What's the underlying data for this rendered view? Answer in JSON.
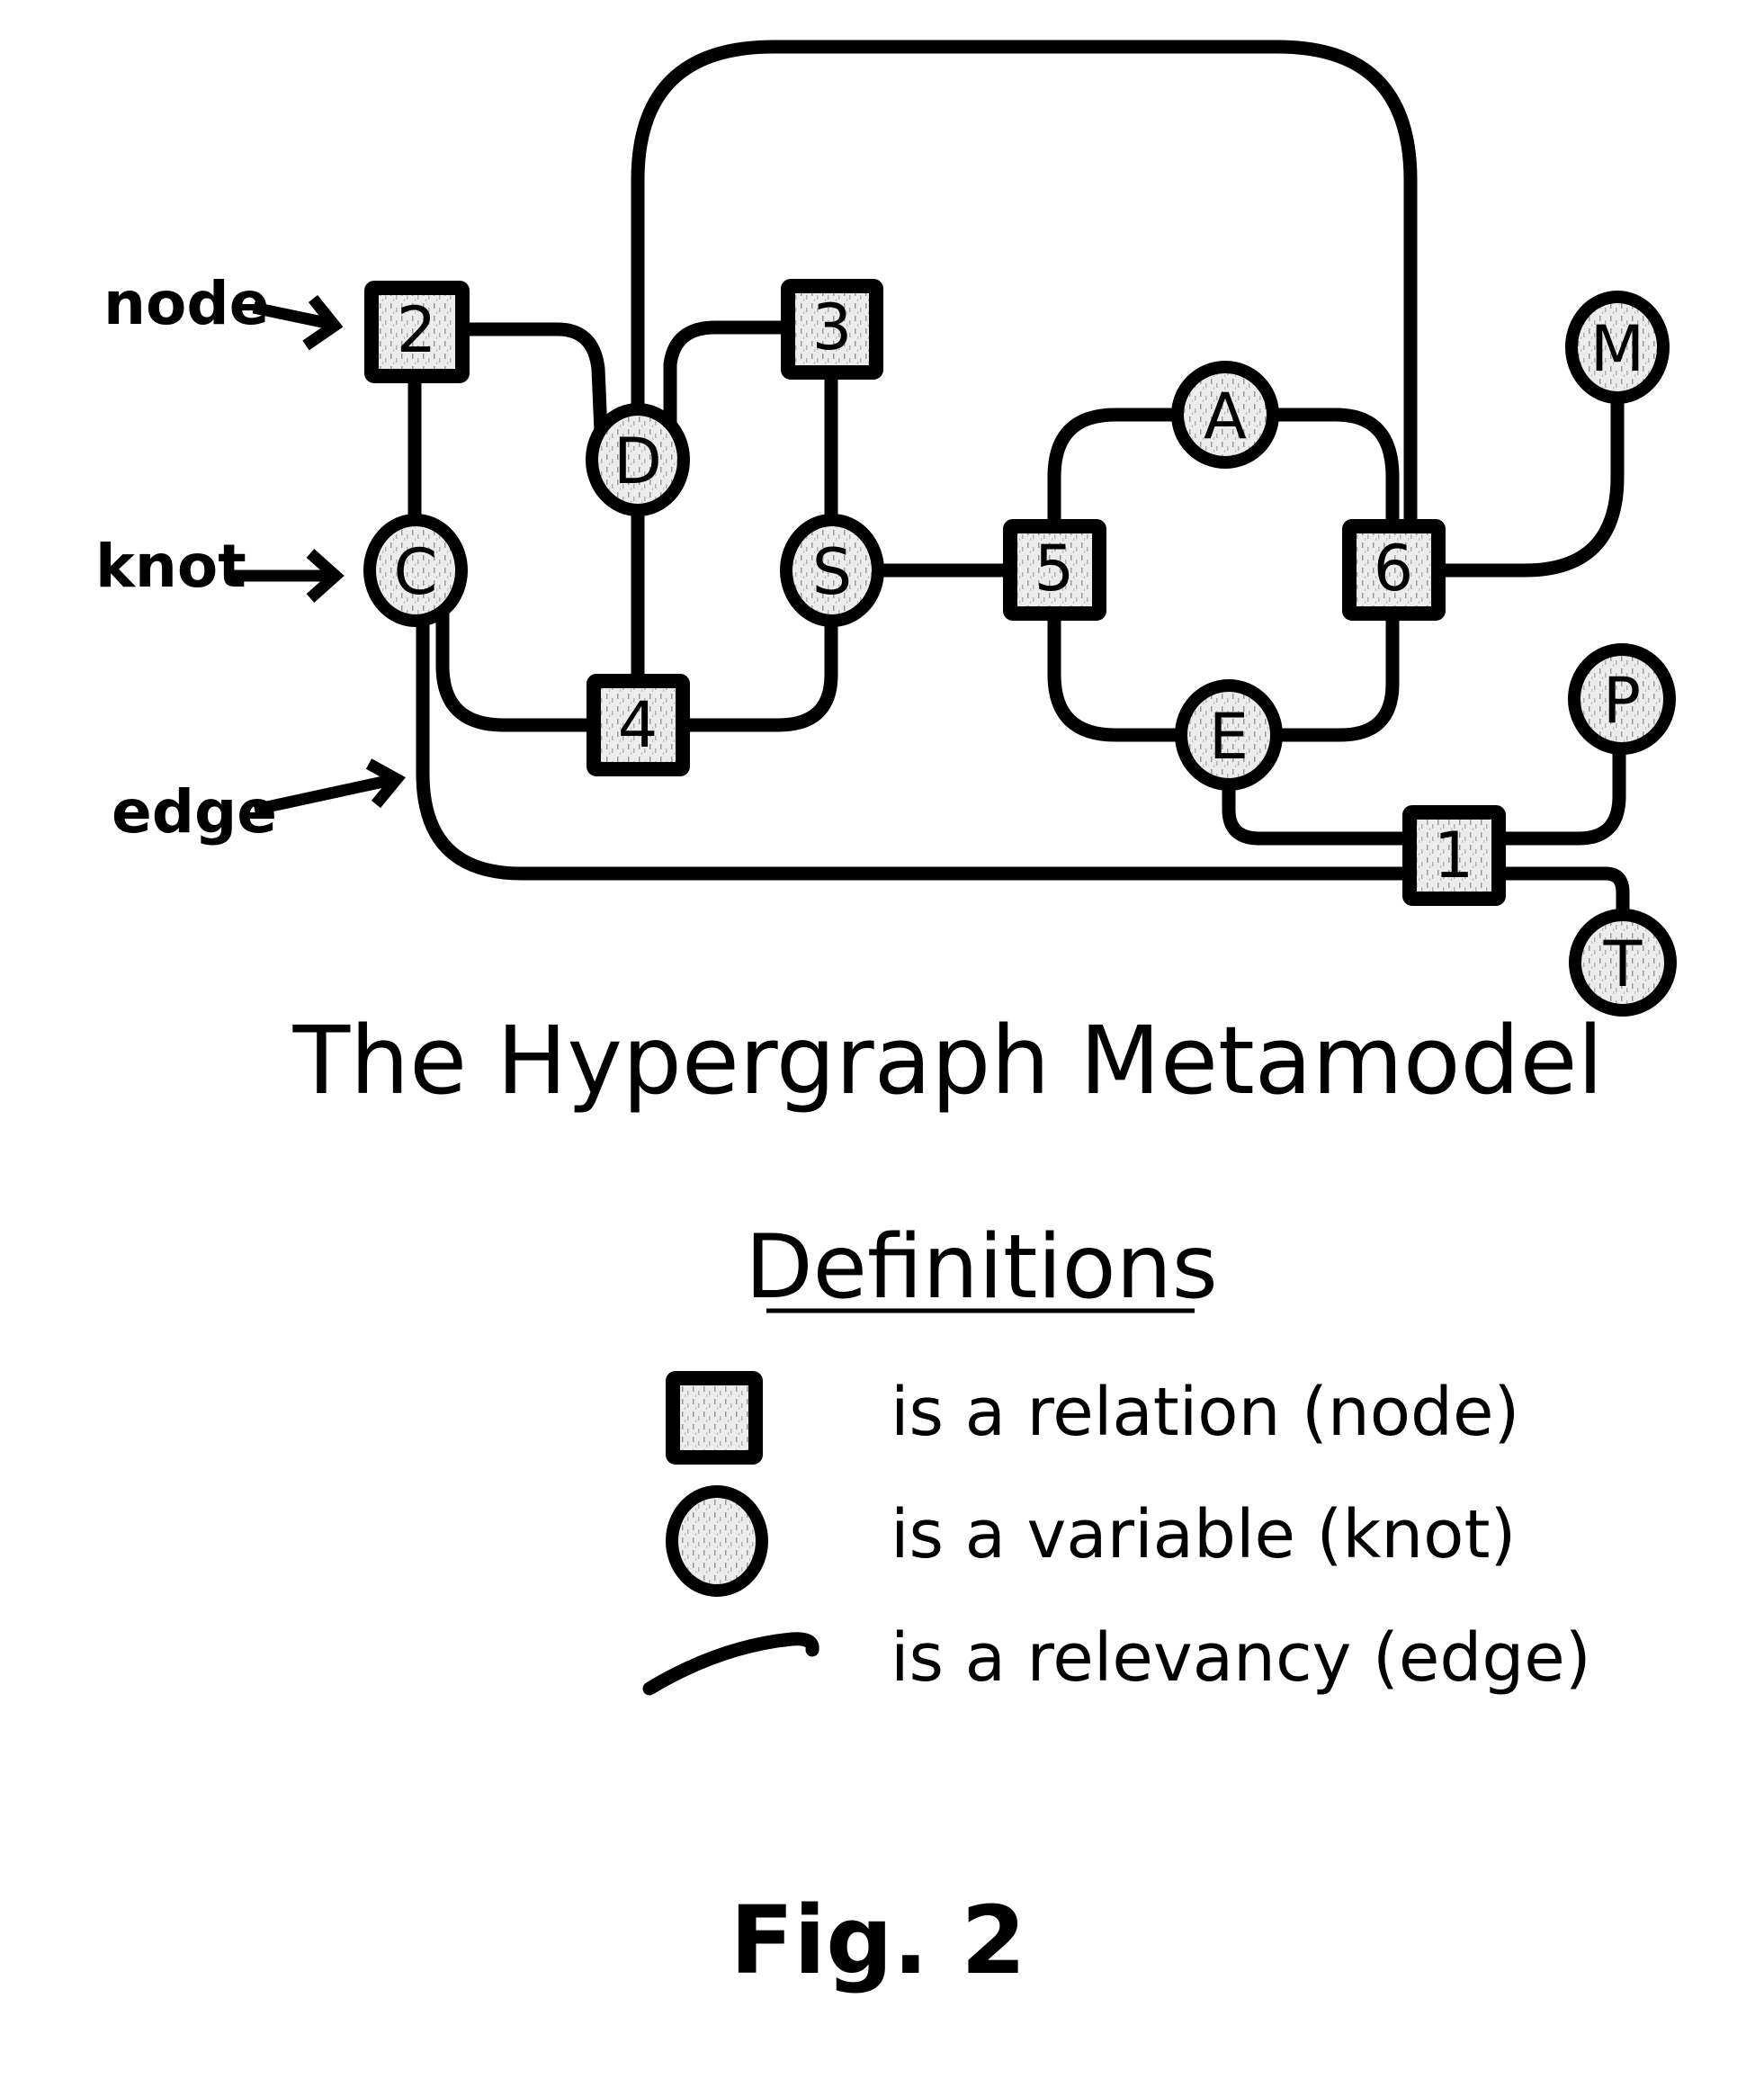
{
  "figure": {
    "title": "The Hypergraph Metamodel",
    "caption": "Fig. 2"
  },
  "pointers": {
    "node": "node",
    "knot": "knot",
    "edge": "edge"
  },
  "relations": [
    {
      "id": "2",
      "label": "2"
    },
    {
      "id": "3",
      "label": "3"
    },
    {
      "id": "4",
      "label": "4"
    },
    {
      "id": "5",
      "label": "5"
    },
    {
      "id": "6",
      "label": "6"
    },
    {
      "id": "1",
      "label": "1"
    }
  ],
  "variables": [
    {
      "id": "D",
      "label": "D"
    },
    {
      "id": "C",
      "label": "C"
    },
    {
      "id": "S",
      "label": "S"
    },
    {
      "id": "A",
      "label": "A"
    },
    {
      "id": "E",
      "label": "E"
    },
    {
      "id": "M",
      "label": "M"
    },
    {
      "id": "P",
      "label": "P"
    },
    {
      "id": "T",
      "label": "T"
    }
  ],
  "relevancies": [
    [
      "2",
      "C"
    ],
    [
      "2",
      "D"
    ],
    [
      "3",
      "D"
    ],
    [
      "3",
      "S"
    ],
    [
      "D",
      "4"
    ],
    [
      "D",
      "6"
    ],
    [
      "C",
      "4"
    ],
    [
      "C",
      "1"
    ],
    [
      "4",
      "S"
    ],
    [
      "S",
      "5"
    ],
    [
      "5",
      "A"
    ],
    [
      "5",
      "E"
    ],
    [
      "A",
      "6"
    ],
    [
      "E",
      "6"
    ],
    [
      "6",
      "M"
    ],
    [
      "E",
      "1"
    ],
    [
      "1",
      "P"
    ],
    [
      "1",
      "T"
    ]
  ],
  "definitions": {
    "heading": "Definitions",
    "items": [
      {
        "symbol": "square",
        "text": "is a relation (node)"
      },
      {
        "symbol": "circle",
        "text": "is a variable (knot)"
      },
      {
        "symbol": "curve",
        "text": "is a relevancy (edge)"
      }
    ]
  },
  "colors": {
    "ink": "#000000",
    "fill": "#e6e6e6",
    "background": "#ffffff"
  }
}
